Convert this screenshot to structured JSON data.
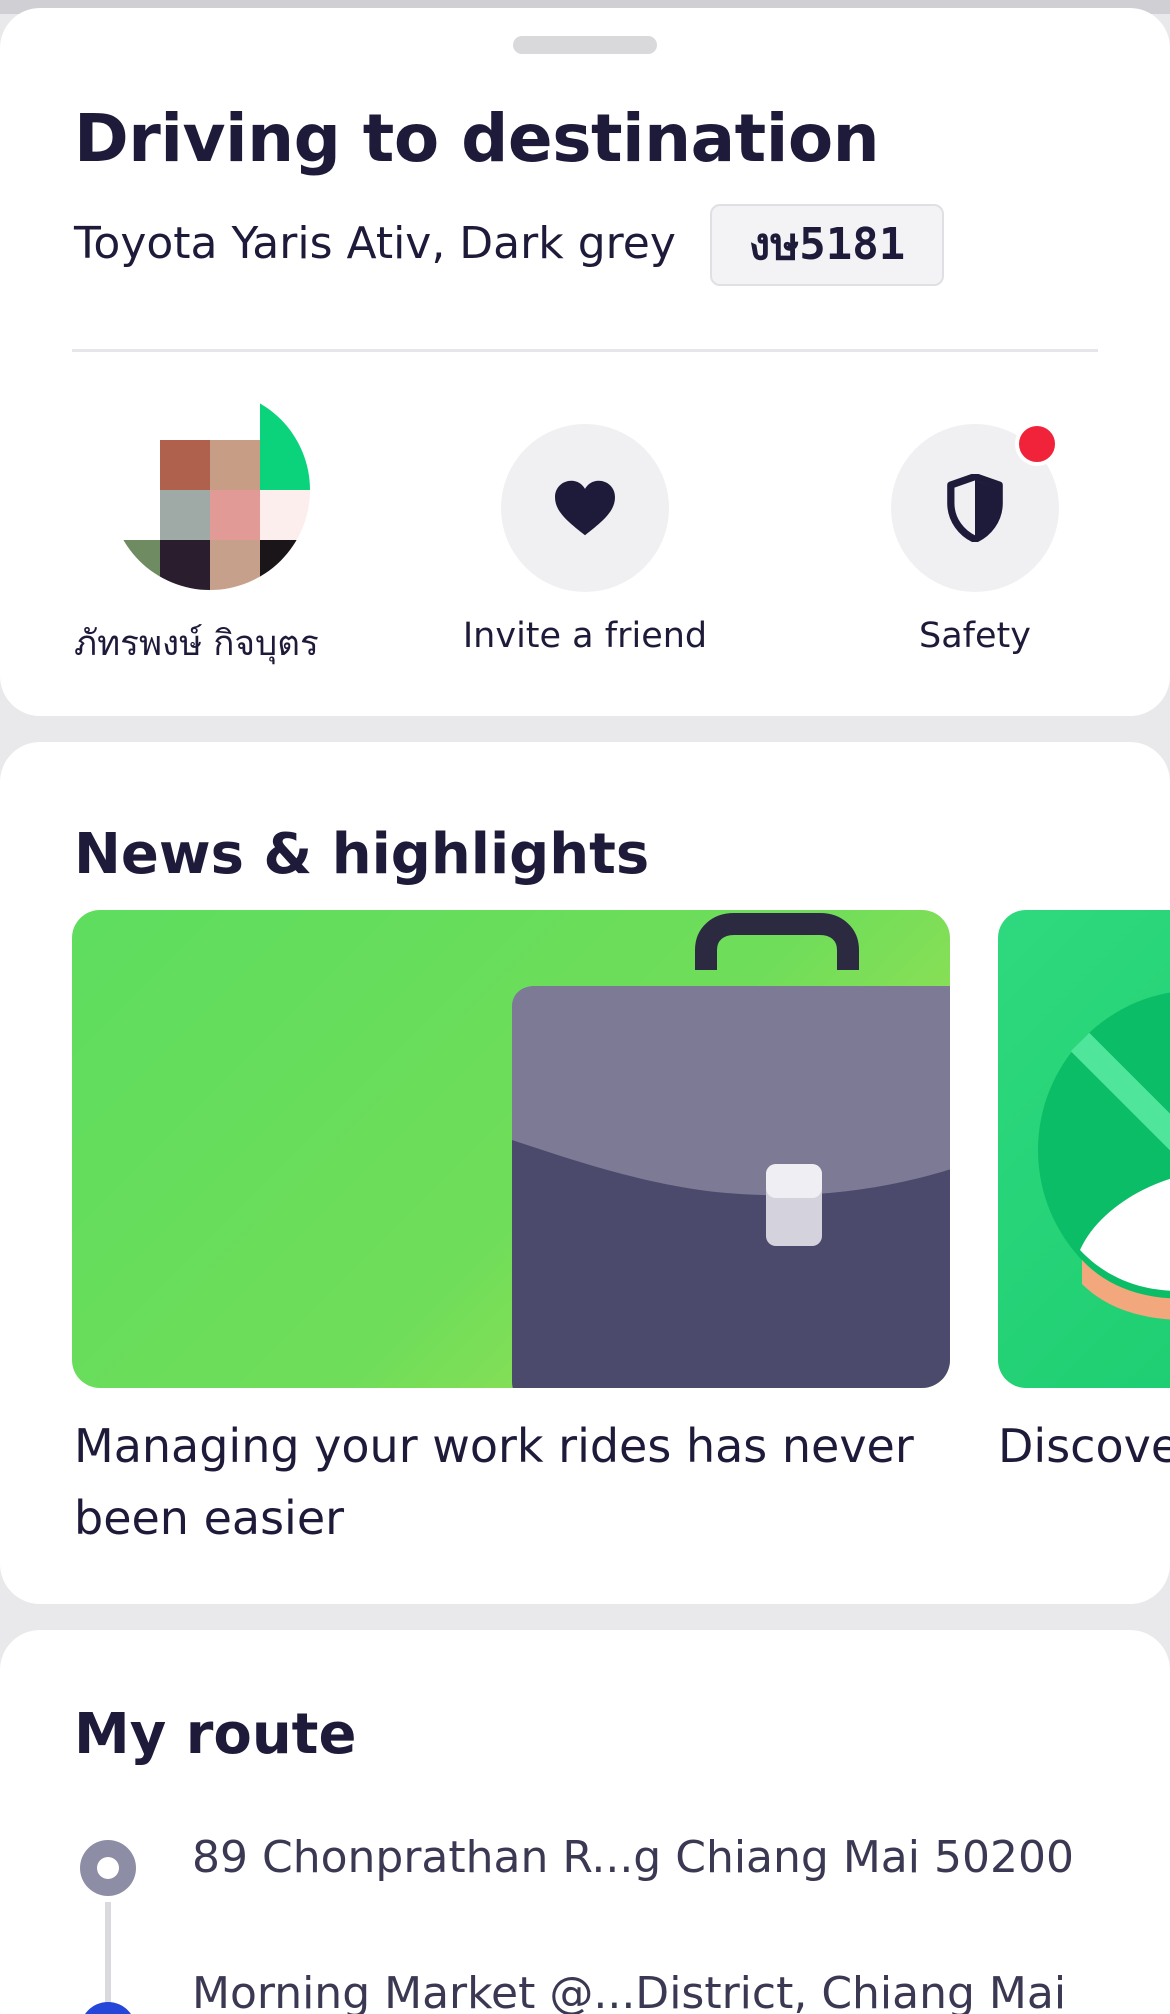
{
  "ride": {
    "title": "Driving to destination",
    "vehicle": "Toyota Yaris Ativ, Dark grey",
    "plate": "งษ5181"
  },
  "actions": [
    {
      "label": "ภัทรพงษ์ กิจบุตร",
      "icon": "driver-avatar"
    },
    {
      "label": "Invite a friend",
      "icon": "heart-icon"
    },
    {
      "label": "Safety",
      "icon": "shield-icon",
      "has_notification": true
    }
  ],
  "news": {
    "title": "News & highlights",
    "items": [
      {
        "caption": "Managing your work rides has never been easier",
        "icon": "briefcase-illustration"
      },
      {
        "caption": "Discove",
        "icon": "promo-illustration"
      }
    ]
  },
  "route": {
    "title": "My route",
    "pickup": "89 Chonprathan R...g Chiang Mai 50200",
    "destination": "Morning Market @...District, Chiang Mai"
  },
  "colors": {
    "primary_text": "#1e1b3a",
    "notification": "#f0233a",
    "banner_green": "#5edd5e",
    "destination_pin": "#2546d8"
  }
}
